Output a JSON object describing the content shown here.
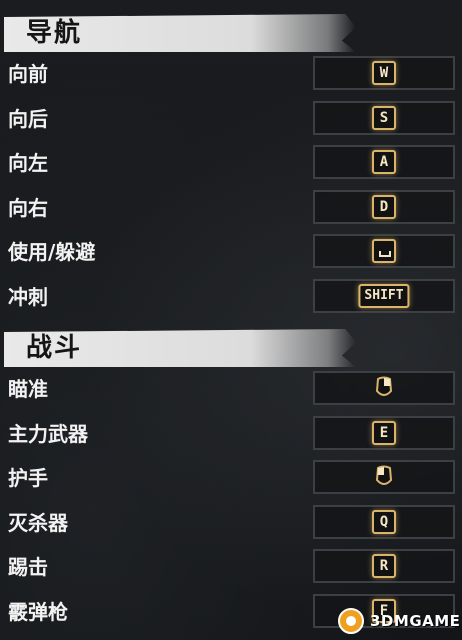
{
  "sections": [
    {
      "title": "导航",
      "rows": [
        {
          "label": "向前",
          "key": "W"
        },
        {
          "label": "向后",
          "key": "S"
        },
        {
          "label": "向左",
          "key": "A"
        },
        {
          "label": "向右",
          "key": "D"
        },
        {
          "label": "使用/躲避",
          "key": "",
          "icon": "spacebar-icon"
        },
        {
          "label": "冲刺",
          "key": "SHIFT"
        }
      ]
    },
    {
      "title": "战斗",
      "rows": [
        {
          "label": "瞄准",
          "key": "",
          "icon": "right-mouse-button-icon"
        },
        {
          "label": "主力武器",
          "key": "E"
        },
        {
          "label": "护手",
          "key": "",
          "icon": "left-mouse-button-icon"
        },
        {
          "label": "灭杀器",
          "key": "Q"
        },
        {
          "label": "踢击",
          "key": "R"
        },
        {
          "label": "霰弹枪",
          "key": "F"
        }
      ]
    }
  ],
  "watermark": {
    "text": "3DMGAME"
  },
  "colors": {
    "accent": "#d9b46a",
    "header_bg": "#e5e5e5",
    "text": "#f2f2f2"
  }
}
